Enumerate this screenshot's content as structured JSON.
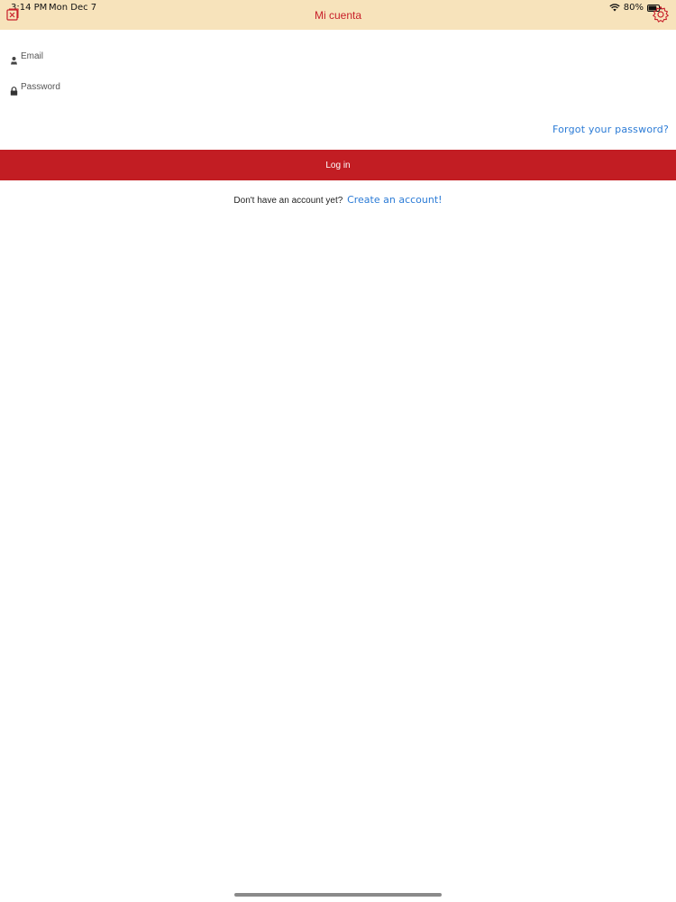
{
  "status_bar": {
    "time": "3:14 PM",
    "date": "Mon Dec 7",
    "battery": "80%",
    "battery_level": 0.8,
    "wifi_icon": "wifi-icon",
    "battery_icon": "battery-icon"
  },
  "header": {
    "title": "Mi cuenta",
    "left_icon": "close-icon",
    "right_icon": "gear-icon",
    "background_color": "#f7e3bb",
    "title_color": "#c8202a"
  },
  "login_form": {
    "email": {
      "icon": "user-icon",
      "placeholder": "Email",
      "value": ""
    },
    "password": {
      "icon": "lock-icon",
      "placeholder": "Password",
      "value": ""
    },
    "forgot_password_label": "Forgot your password?",
    "login_button_label": "Log in",
    "login_button_color": "#c21d23"
  },
  "signup": {
    "prompt": "Don't have an account yet?",
    "link_label": "Create an account!",
    "link_color": "#2b7bd6"
  }
}
